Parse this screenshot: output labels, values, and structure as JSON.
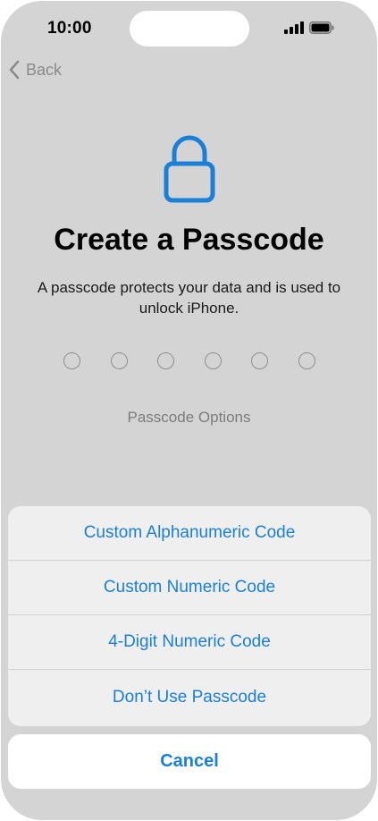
{
  "status_bar": {
    "time": "10:00"
  },
  "nav": {
    "back_label": "Back"
  },
  "content": {
    "title": "Create a Passcode",
    "subtitle": "A passcode protects your data and is used to unlock iPhone.",
    "passcode_digits": 6,
    "options_link": "Passcode Options"
  },
  "action_sheet": {
    "items": [
      {
        "label": "Custom Alphanumeric Code"
      },
      {
        "label": "Custom Numeric Code"
      },
      {
        "label": "4-Digit Numeric Code"
      },
      {
        "label": "Don’t Use Passcode"
      }
    ],
    "cancel_label": "Cancel"
  },
  "colors": {
    "accent": "#1a7fd6",
    "dimmed_background": "#d4d4d4",
    "sheet_background": "#efefef"
  },
  "icons": [
    "signal-icon",
    "battery-icon",
    "chevron-left-icon",
    "lock-icon"
  ]
}
